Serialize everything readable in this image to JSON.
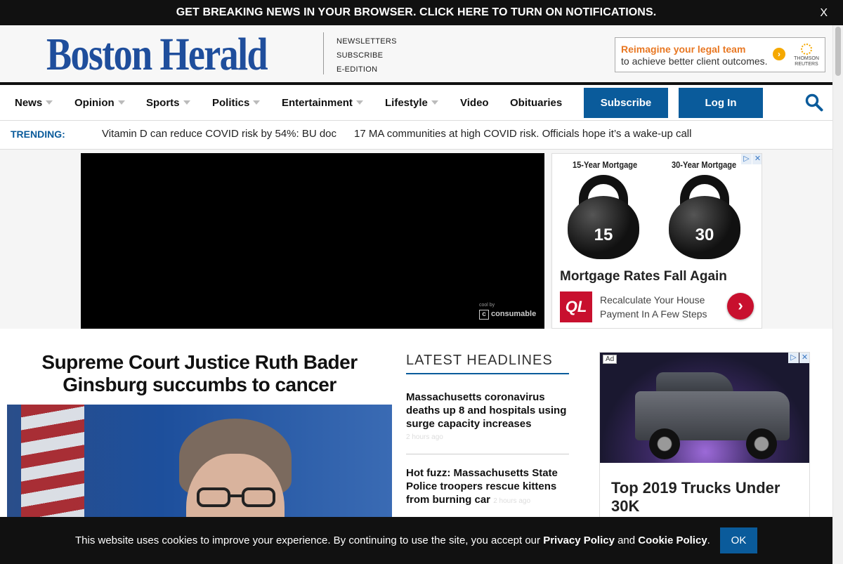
{
  "notification": {
    "text": "GET BREAKING NEWS IN YOUR BROWSER. CLICK HERE TO TURN ON NOTIFICATIONS.",
    "close": "X"
  },
  "masthead": {
    "logo": "Boston Herald",
    "links": [
      "NEWSLETTERS",
      "SUBSCRIBE",
      "E-EDITION"
    ],
    "ad": {
      "line1": "Reimagine your legal team",
      "line2": "to achieve better client outcomes.",
      "brand": "THOMSON REUTERS"
    }
  },
  "nav": {
    "items": [
      {
        "label": "News"
      },
      {
        "label": "Opinion"
      },
      {
        "label": "Sports"
      },
      {
        "label": "Politics"
      },
      {
        "label": "Entertainment"
      },
      {
        "label": "Lifestyle"
      },
      {
        "label": "Video"
      },
      {
        "label": "Obituaries"
      }
    ],
    "subscribe": "Subscribe",
    "login": "Log In"
  },
  "trending": {
    "label": "TRENDING:",
    "items": [
      "Vitamin D can reduce COVID risk by 54%: BU doc",
      "17 MA communities at high COVID risk. Officials hope it’s a wake-up call"
    ]
  },
  "video": {
    "powered_small": "cool by",
    "powered_brand": "consumable"
  },
  "mortgage_ad": {
    "label15": "15-Year Mortgage",
    "label30": "30-Year Mortgage",
    "num15": "15",
    "num30": "30",
    "title": "Mortgage Rates Fall Again",
    "logo": "QL",
    "subtitle": "Recalculate Your House Payment In A Few Steps"
  },
  "main": {
    "headline": "Supreme Court Justice Ruth Bader Ginsburg succumbs to cancer"
  },
  "latest": {
    "title": "LATEST HEADLINES",
    "items": [
      {
        "text": "Massachusetts coronavirus deaths up 8 and hospitals using surge capacity increases",
        "time": "2 hours ago"
      },
      {
        "text": "Hot fuzz: Massachusetts State Police troopers rescue kittens from burning car",
        "time": "2 hours ago"
      }
    ]
  },
  "truck_ad": {
    "tag": "Ad",
    "title": "Top 2019 Trucks Under 30K"
  },
  "cookie": {
    "before": "This website uses cookies to improve your experience. By continuing to use the site, you accept our ",
    "privacy": "Privacy Policy",
    "and": " and ",
    "cookie_policy": "Cookie Policy",
    "end": ".",
    "ok": "OK"
  },
  "colors": {
    "brand_blue": "#1f4e9c",
    "button_blue": "#0a5b9b",
    "ql_red": "#c8102e"
  }
}
